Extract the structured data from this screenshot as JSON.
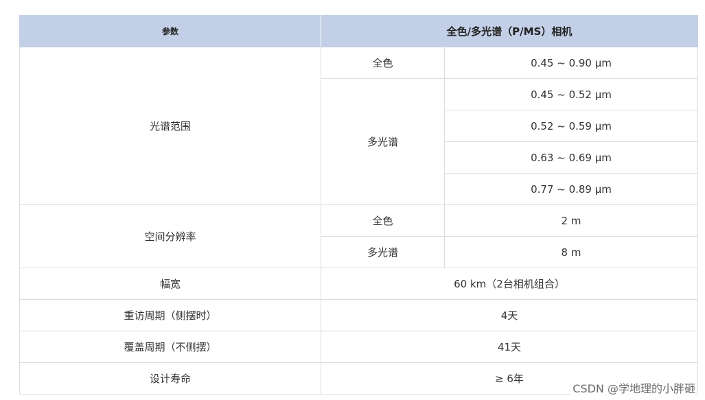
{
  "header": {
    "param": "参数",
    "camera": "全色/多光谱（P/MS）相机"
  },
  "spectral": {
    "label": "光谱范围",
    "pan_label": "全色",
    "pan_value": "0.45 ~ 0.90 μm",
    "ms_label": "多光谱",
    "ms_values": [
      "0.45 ~ 0.52 μm",
      "0.52 ~ 0.59 μm",
      "0.63 ~ 0.69 μm",
      "0.77 ~ 0.89 μm"
    ]
  },
  "resolution": {
    "label": "空间分辨率",
    "pan_label": "全色",
    "pan_value": "2 m",
    "ms_label": "多光谱",
    "ms_value": "8 m"
  },
  "rows": [
    {
      "label": "幅宽",
      "value": "60 km（2台相机组合）"
    },
    {
      "label": "重访周期（侧摆时）",
      "value": "4天"
    },
    {
      "label": "覆盖周期（不侧摆）",
      "value": "41天"
    },
    {
      "label": "设计寿命",
      "value": "≥ 6年"
    }
  ],
  "watermark": "CSDN @学地理的小胖砸"
}
